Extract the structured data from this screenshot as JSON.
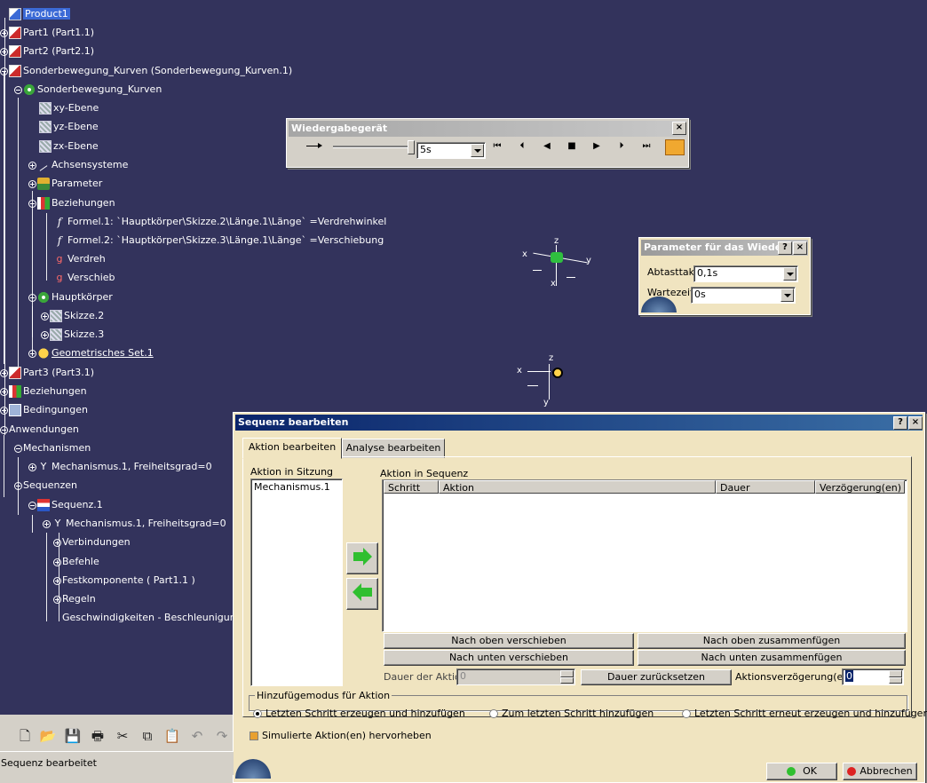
{
  "tree": {
    "items": [
      {
        "label": "Product1",
        "icon": "product-icon"
      },
      {
        "label": "Part1 (Part1.1)",
        "icon": "part-icon"
      },
      {
        "label": "Part2 (Part2.1)",
        "icon": "part-icon"
      },
      {
        "label": "Sonderbewegung_Kurven (Sonderbewegung_Kurven.1)",
        "icon": "part-icon"
      },
      {
        "label": "Sonderbewegung_Kurven",
        "icon": "part-body-icon"
      },
      {
        "label": "xy-Ebene",
        "icon": "plane-icon"
      },
      {
        "label": "yz-Ebene",
        "icon": "plane-icon"
      },
      {
        "label": "zx-Ebene",
        "icon": "plane-icon"
      },
      {
        "label": "Achsensysteme",
        "icon": "axis-system-icon"
      },
      {
        "label": "Parameter",
        "icon": "parameter-icon"
      },
      {
        "label": "Beziehungen",
        "icon": "relations-icon"
      },
      {
        "label": "Formel.1: `Hauptkörper\\Skizze.2\\Länge.1\\Länge` =Verdrehwinkel",
        "icon": "formula-icon"
      },
      {
        "label": "Formel.2: `Hauptkörper\\Skizze.3\\Länge.1\\Länge` =Verschiebung",
        "icon": "formula-icon"
      },
      {
        "label": "Verdreh",
        "icon": "variable-icon"
      },
      {
        "label": "Verschieb",
        "icon": "variable-icon"
      },
      {
        "label": "Hauptkörper",
        "icon": "body-icon"
      },
      {
        "label": "Skizze.2",
        "icon": "sketch-icon"
      },
      {
        "label": "Skizze.3",
        "icon": "sketch-icon"
      },
      {
        "label": "Geometrisches Set.1",
        "icon": "geometrical-set-icon"
      },
      {
        "label": "Part3 (Part3.1)",
        "icon": "part-icon"
      },
      {
        "label": "Beziehungen",
        "icon": "relations-icon"
      },
      {
        "label": "Bedingungen",
        "icon": "constraints-icon"
      },
      {
        "label": "Anwendungen",
        "icon": ""
      },
      {
        "label": "Mechanismen",
        "icon": ""
      },
      {
        "label": "Mechanismus.1, Freiheitsgrad=0",
        "icon": "mechanism-icon"
      },
      {
        "label": "Sequenzen",
        "icon": ""
      },
      {
        "label": "Sequenz.1",
        "icon": "sequence-icon"
      },
      {
        "label": "Mechanismus.1, Freiheitsgrad=0",
        "icon": "mechanism-icon"
      },
      {
        "label": "Verbindungen",
        "icon": ""
      },
      {
        "label": "Befehle",
        "icon": ""
      },
      {
        "label": "Festkomponente ( Part1.1 )",
        "icon": ""
      },
      {
        "label": "Regeln",
        "icon": ""
      },
      {
        "label": "Geschwindigkeiten - Beschleunigungen",
        "icon": ""
      }
    ]
  },
  "compass": {
    "x": "x",
    "y": "y",
    "z": "z"
  },
  "player": {
    "title": "Wiedergabegerät",
    "step_value": "5s",
    "close": "×",
    "controls": [
      "skip-to-start-icon",
      "step-back-icon",
      "play-back-icon",
      "stop-icon",
      "play-forward-icon",
      "step-forward-icon",
      "skip-to-end-icon",
      "player-parameters-icon"
    ]
  },
  "params": {
    "title": "Parameter für das Wiede...",
    "help": "?",
    "close": "×",
    "sample_label": "Abtasttakt",
    "sample_value": "0,1s",
    "wait_label": "Wartezeit",
    "wait_value": "0s"
  },
  "sequence": {
    "title": "Sequenz bearbeiten",
    "help": "?",
    "close": "×",
    "tabs": [
      "Aktion bearbeiten",
      "Analyse bearbeiten"
    ],
    "session_label": "Aktion in Sitzung",
    "session_items": [
      "Mechanismus.1"
    ],
    "sequence_label": "Aktion in Sequenz",
    "columns": [
      "Schritt",
      "Aktion",
      "Dauer",
      "Verzögerung(en)"
    ],
    "buttons": {
      "move_up": "Nach oben verschieben",
      "merge_up": "Nach oben zusammenfügen",
      "move_down": "Nach unten verschieben",
      "merge_down": "Nach unten zusammenfügen",
      "reset_duration": "Dauer zurücksetzen"
    },
    "duration_label": "Dauer der Aktion",
    "duration_value": "0",
    "delay_label": "Aktionsverzögerung(en)",
    "delay_value": "0",
    "add_mode_label": "Hinzufügemodus für Aktion",
    "radio_options": [
      "Letzten Schritt erzeugen und hinzufügen",
      "Zum letzten Schritt hinzufügen",
      "Letzten Schritt erneut erzeugen und hinzufügen"
    ],
    "selected_radio": 0,
    "highlight_label": "Simulierte Aktion(en) hervorheben",
    "ok": "OK",
    "cancel": "Abbrechen"
  },
  "toolbar": {
    "icons": [
      "new-icon",
      "open-icon",
      "save-icon",
      "print-icon",
      "cut-icon",
      "copy-icon",
      "paste-icon",
      "undo-icon",
      "redo-icon"
    ]
  },
  "status": {
    "text": "Sequenz bearbeitet"
  }
}
